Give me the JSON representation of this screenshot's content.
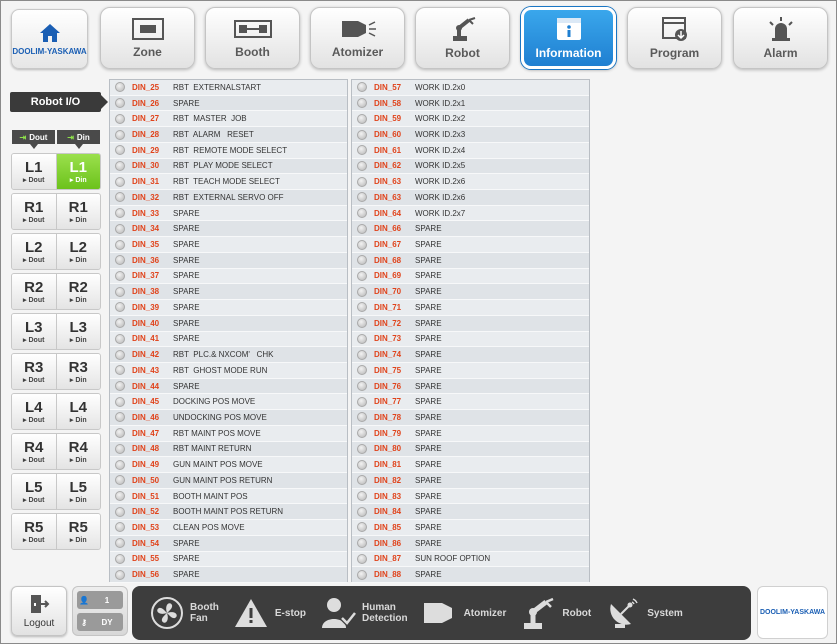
{
  "brand": "DOOLIM-YASKAWA",
  "nav": [
    {
      "label": "Zone",
      "icon": "zone-icon"
    },
    {
      "label": "Booth",
      "icon": "booth-icon"
    },
    {
      "label": "Atomizer",
      "icon": "atomizer-icon"
    },
    {
      "label": "Robot",
      "icon": "robot-arm-icon"
    },
    {
      "label": "Information",
      "icon": "information-icon",
      "active": true
    },
    {
      "label": "Program",
      "icon": "program-icon"
    },
    {
      "label": "Alarm",
      "icon": "alarm-icon"
    }
  ],
  "left": {
    "title": "Robot I/O",
    "dout_tag": "Dout",
    "din_tag": "Din",
    "rows": [
      {
        "name": "L1",
        "dout": "Dout",
        "din": "Din",
        "din_active": true
      },
      {
        "name": "R1",
        "dout": "Dout",
        "din": "Din"
      },
      {
        "name": "L2",
        "dout": "Dout",
        "din": "Din"
      },
      {
        "name": "R2",
        "dout": "Dout",
        "din": "Din"
      },
      {
        "name": "L3",
        "dout": "Dout",
        "din": "Din"
      },
      {
        "name": "R3",
        "dout": "Dout",
        "din": "Din"
      },
      {
        "name": "L4",
        "dout": "Dout",
        "din": "Din"
      },
      {
        "name": "R4",
        "dout": "Dout",
        "din": "Din"
      },
      {
        "name": "L5",
        "dout": "Dout",
        "din": "Din"
      },
      {
        "name": "R5",
        "dout": "Dout",
        "din": "Din"
      }
    ]
  },
  "table_left": [
    {
      "code": "DIN_25",
      "desc": "RBT  EXTERNALSTART"
    },
    {
      "code": "DIN_26",
      "desc": "SPARE"
    },
    {
      "code": "DIN_27",
      "desc": "RBT  MASTER  JOB"
    },
    {
      "code": "DIN_28",
      "desc": "RBT  ALARM   RESET"
    },
    {
      "code": "DIN_29",
      "desc": "RBT  REMOTE MODE SELECT"
    },
    {
      "code": "DIN_30",
      "desc": "RBT  PLAY MODE SELECT"
    },
    {
      "code": "DIN_31",
      "desc": "RBT  TEACH MODE SELECT"
    },
    {
      "code": "DIN_32",
      "desc": "RBT  EXTERNAL SERVO OFF"
    },
    {
      "code": "DIN_33",
      "desc": "SPARE"
    },
    {
      "code": "DIN_34",
      "desc": "SPARE"
    },
    {
      "code": "DIN_35",
      "desc": "SPARE"
    },
    {
      "code": "DIN_36",
      "desc": "SPARE"
    },
    {
      "code": "DIN_37",
      "desc": "SPARE"
    },
    {
      "code": "DIN_38",
      "desc": "SPARE"
    },
    {
      "code": "DIN_39",
      "desc": "SPARE"
    },
    {
      "code": "DIN_40",
      "desc": "SPARE"
    },
    {
      "code": "DIN_41",
      "desc": "SPARE"
    },
    {
      "code": "DIN_42",
      "desc": "RBT  PLC.& NXCOM'   CHK"
    },
    {
      "code": "DIN_43",
      "desc": "RBT  GHOST MODE RUN"
    },
    {
      "code": "DIN_44",
      "desc": "SPARE"
    },
    {
      "code": "DIN_45",
      "desc": "DOCKING POS MOVE"
    },
    {
      "code": "DIN_46",
      "desc": "UNDOCKING POS MOVE"
    },
    {
      "code": "DIN_47",
      "desc": "RBT MAINT POS MOVE"
    },
    {
      "code": "DIN_48",
      "desc": "RBT MAINT RETURN"
    },
    {
      "code": "DIN_49",
      "desc": "GUN MAINT POS MOVE"
    },
    {
      "code": "DIN_50",
      "desc": "GUN MAINT POS RETURN"
    },
    {
      "code": "DIN_51",
      "desc": "BOOTH MAINT POS"
    },
    {
      "code": "DIN_52",
      "desc": "BOOTH MAINT POS RETURN"
    },
    {
      "code": "DIN_53",
      "desc": "CLEAN POS MOVE"
    },
    {
      "code": "DIN_54",
      "desc": "SPARE"
    },
    {
      "code": "DIN_55",
      "desc": "SPARE"
    },
    {
      "code": "DIN_56",
      "desc": "SPARE"
    }
  ],
  "table_right": [
    {
      "code": "DIN_57",
      "desc": "WORK ID.2x0"
    },
    {
      "code": "DIN_58",
      "desc": "WORK ID.2x1"
    },
    {
      "code": "DIN_59",
      "desc": "WORK ID.2x2"
    },
    {
      "code": "DIN_60",
      "desc": "WORK ID.2x3"
    },
    {
      "code": "DIN_61",
      "desc": "WORK ID.2x4"
    },
    {
      "code": "DIN_62",
      "desc": "WORK ID.2x5"
    },
    {
      "code": "DIN_63",
      "desc": "WORK ID.2x6"
    },
    {
      "code": "DIN_63",
      "desc": "WORK ID.2x6"
    },
    {
      "code": "DIN_64",
      "desc": "WORK ID.2x7"
    },
    {
      "code": "DIN_66",
      "desc": "SPARE"
    },
    {
      "code": "DIN_67",
      "desc": "SPARE"
    },
    {
      "code": "DIN_68",
      "desc": "SPARE"
    },
    {
      "code": "DIN_69",
      "desc": "SPARE"
    },
    {
      "code": "DIN_70",
      "desc": "SPARE"
    },
    {
      "code": "DIN_71",
      "desc": "SPARE"
    },
    {
      "code": "DIN_72",
      "desc": "SPARE"
    },
    {
      "code": "DIN_73",
      "desc": "SPARE"
    },
    {
      "code": "DIN_74",
      "desc": "SPARE"
    },
    {
      "code": "DIN_75",
      "desc": "SPARE"
    },
    {
      "code": "DIN_76",
      "desc": "SPARE"
    },
    {
      "code": "DIN_77",
      "desc": "SPARE"
    },
    {
      "code": "DIN_78",
      "desc": "SPARE"
    },
    {
      "code": "DIN_79",
      "desc": "SPARE"
    },
    {
      "code": "DIN_80",
      "desc": "SPARE"
    },
    {
      "code": "DIN_81",
      "desc": "SPARE"
    },
    {
      "code": "DIN_82",
      "desc": "SPARE"
    },
    {
      "code": "DIN_83",
      "desc": "SPARE"
    },
    {
      "code": "DIN_84",
      "desc": "SPARE"
    },
    {
      "code": "DIN_85",
      "desc": "SPARE"
    },
    {
      "code": "DIN_86",
      "desc": "SPARE"
    },
    {
      "code": "DIN_87",
      "desc": "SUN ROOF OPTION"
    },
    {
      "code": "DIN_88",
      "desc": "SPARE"
    }
  ],
  "bottom": {
    "logout_label": "Logout",
    "user_level": "1",
    "user_name": "DY",
    "status": [
      {
        "label1": "Booth",
        "label2": "Fan",
        "icon": "fan-icon"
      },
      {
        "label1": "E-stop",
        "label2": "",
        "icon": "warning-icon"
      },
      {
        "label1": "Human",
        "label2": "Detection",
        "icon": "human-detection-icon"
      },
      {
        "label1": "Atomizer",
        "label2": "",
        "icon": "atomizer-icon"
      },
      {
        "label1": "Robot",
        "label2": "",
        "icon": "robot-arm-icon"
      },
      {
        "label1": "System",
        "label2": "",
        "icon": "satellite-dish-icon"
      }
    ]
  },
  "colors": {
    "accent": "#1f7fd1",
    "din_active": "#6cc21b",
    "code_text": "#e0431b"
  }
}
